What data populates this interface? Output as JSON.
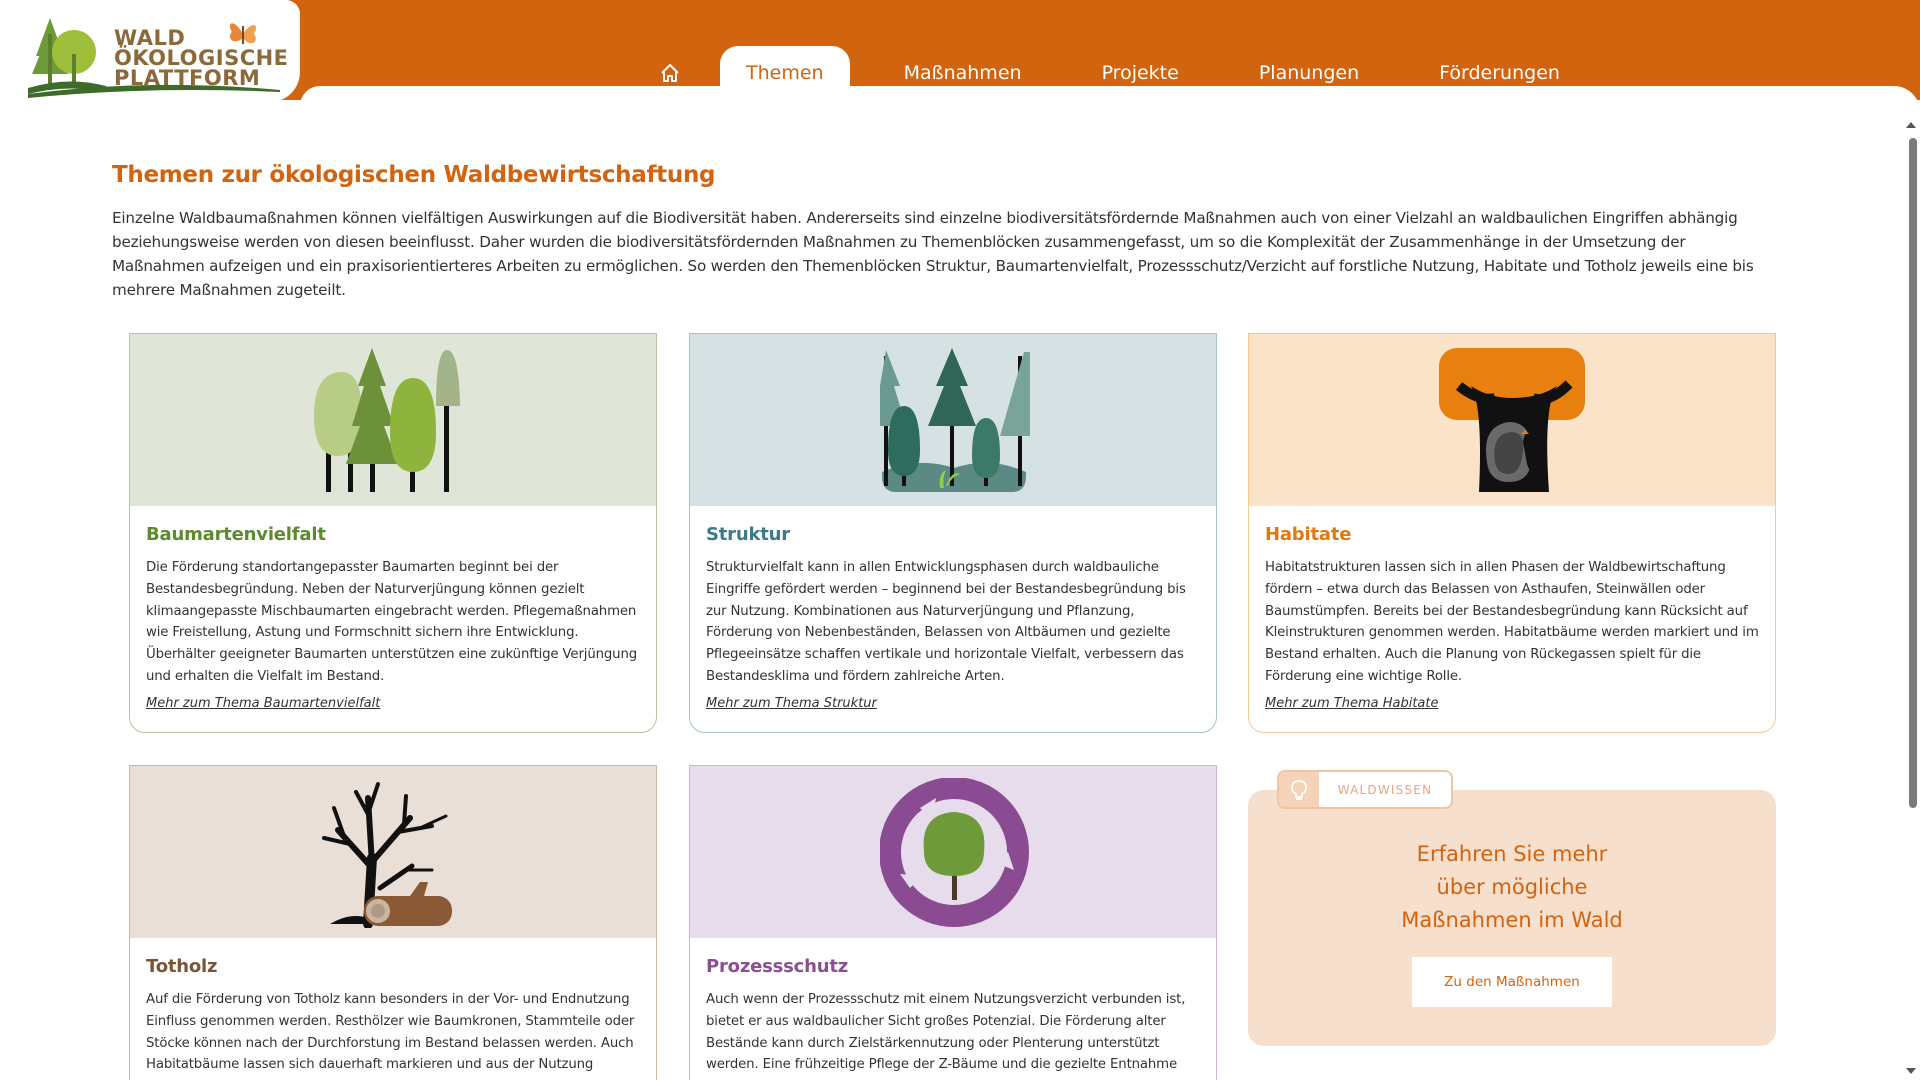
{
  "header": {
    "logo_lines": [
      "WALD",
      "ÖKOLOGISCHE",
      "PLATTFORM"
    ],
    "nav": [
      {
        "label": "Themen",
        "active": true
      },
      {
        "label": "Maßnahmen",
        "active": false
      },
      {
        "label": "Projekte",
        "active": false
      },
      {
        "label": "Planungen",
        "active": false
      },
      {
        "label": "Förderungen",
        "active": false
      }
    ],
    "home_icon": "home-icon",
    "accent_color": "#d2630f"
  },
  "intro": {
    "title": "Themen zur ökologischen Waldbewirtschaftung",
    "text": "Einzelne Waldbaumaßnahmen können vielfältigen Auswirkungen auf die Biodiversität haben. Andererseits sind einzelne biodiversitätsfördernde Maßnahmen auch von einer Vielzahl an waldbaulichen Eingriffen abhängig beziehungsweise werden von diesen beeinflusst. Daher wurden die biodiversitätsfördernden Maßnahmen zu Themenblöcken zusammengefasst, um so die Komplexität der Zusammenhänge in der Umsetzung der Maßnahmen aufzeigen und ein praxisorientierteres Arbeiten zu ermöglichen. So werden den Themenblöcken Struktur, Baumartenvielfalt, Prozessschutz/Verzicht auf forstliche Nutzung, Habitate und Totholz jeweils eine bis mehrere Maßnahmen zugeteilt."
  },
  "cards": [
    {
      "title": "Baumartenvielfalt",
      "text": "Die Förderung standortangepasster Baumarten beginnt bei der Bestandesbegründung. Neben der Naturverjüngung können gezielt klimaangepasste Mischbaumarten eingebracht werden. Pflegemaßnahmen wie Freistellung, Astung und Formschnitt sichern ihre Entwicklung. Überhälter geeigneter Baumarten unterstützen eine zukünftige Verjüngung und erhalten die Vielfalt im Bestand.",
      "link": "Mehr zum Thema Baumartenvielfalt",
      "icon": "trees-icon"
    },
    {
      "title": "Struktur",
      "text": "Strukturvielfalt kann in allen Entwicklungsphasen durch waldbauliche Eingriffe gefördert werden – beginnend bei der Bestandesbegründung bis zur Nutzung. Kombinationen aus Naturverjüngung und Pflanzung, Förderung von Nebenbeständen, Belassen von Altbäumen und gezielte Pflegeeinsätze schaffen vertikale und horizontale Vielfalt, verbessern das Bestandesklima und fördern zahlreiche Arten.",
      "link": "Mehr zum Thema Struktur",
      "icon": "forest-structure-icon"
    },
    {
      "title": "Habitate",
      "text": "Habitatstrukturen lassen sich in allen Phasen der Waldbewirtschaftung fördern – etwa durch das Belassen von Asthaufen, Steinwällen oder Baumstümpfen. Bereits bei der Bestandesbegründung kann Rücksicht auf Kleinstrukturen genommen werden. Habitatbäume werden markiert und im Bestand erhalten. Auch die Planung von Rückegassen spielt für die Förderung eine wichtige Rolle.",
      "link": "Mehr zum Thema Habitate",
      "icon": "habitat-tree-icon"
    },
    {
      "title": "Totholz",
      "text": "Auf die Förderung von Totholz kann besonders in der Vor- und Endnutzung Einfluss genommen werden. Resthölzer wie Baumkronen, Stammteile oder Stöcke können nach der Durchforstung im Bestand belassen werden. Auch Habitatbäume lassen sich dauerhaft markieren und aus der Nutzung nehmen.",
      "icon": "deadwood-icon"
    },
    {
      "title": "Prozessschutz",
      "text": "Auch wenn der Prozessschutz mit einem Nutzungsverzicht verbunden ist, bietet er aus waldbaulicher Sicht großes Potenzial. Die Förderung alter Bestände kann durch Zielstärkennutzung oder Plenterung unterstützt werden. Eine frühzeitige Pflege der Z-Bäume und die gezielte Entnahme einzelner",
      "icon": "cycle-tree-icon"
    }
  ],
  "waldwissen": {
    "tag": "WALDWISSEN",
    "tag_icon": "lightbulb-icon",
    "text_lines": [
      "Erfahren Sie mehr",
      "über mögliche",
      "Maßnahmen im Wald"
    ],
    "button": "Zu den Maßnahmen"
  }
}
